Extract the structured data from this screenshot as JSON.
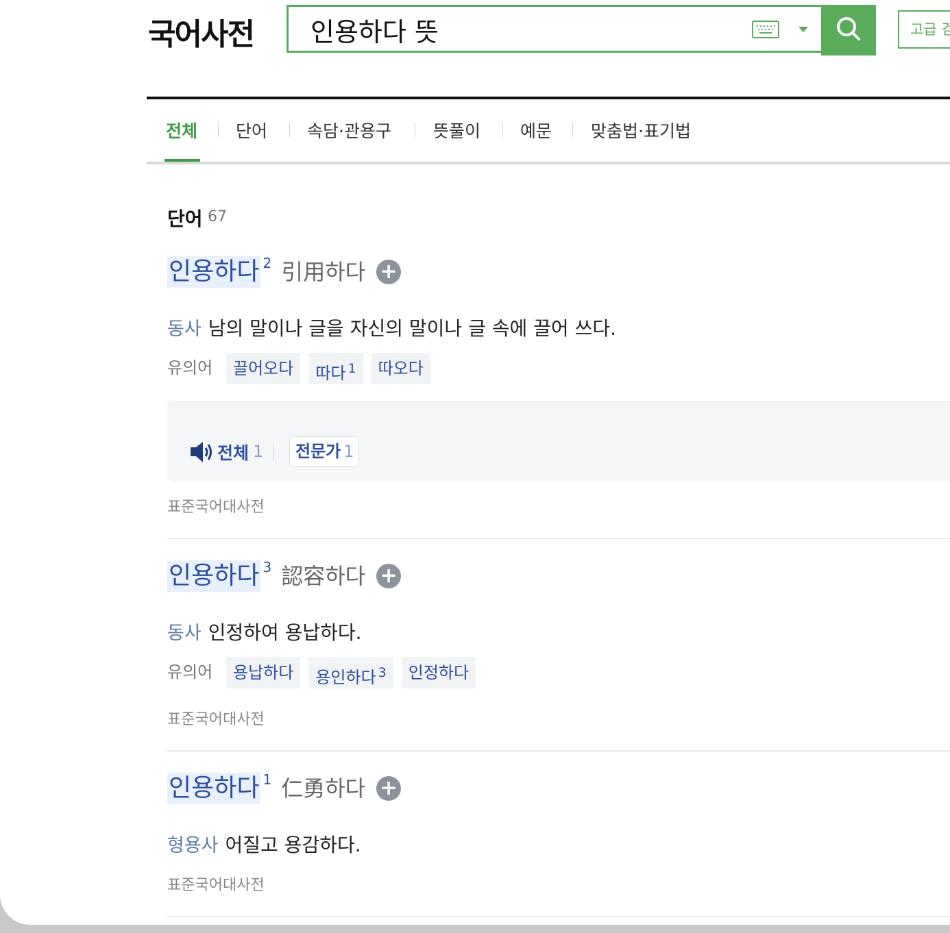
{
  "header": {
    "logo": "국어사전",
    "search_value": "인용하다 뜻",
    "keyboard_icon": "keyboard-icon",
    "dropdown_icon": "triangle-down-icon",
    "search_icon": "search-icon",
    "advanced_label": "고급 검색"
  },
  "tabs": [
    "전체",
    "단어",
    "속담·관용구",
    "뜻풀이",
    "예문",
    "맞춤법·표기법"
  ],
  "section": {
    "title": "단어",
    "count": "67"
  },
  "entries": [
    {
      "headword": "인용하다",
      "homograph": "2",
      "hanja": "引用하다",
      "pos": "동사",
      "definition": "남의 말이나 글을 자신의 말이나 글 속에 끌어 쓰다.",
      "synonym_label": "유의어",
      "synonyms": [
        {
          "word": "끌어오다",
          "sup": ""
        },
        {
          "word": "따다",
          "sup": "1"
        },
        {
          "word": "따오다",
          "sup": ""
        }
      ],
      "pronunciation": {
        "all_label": "전체",
        "all_count": "1",
        "expert_label": "전문가",
        "expert_count": "1"
      },
      "source": "표준국어대사전"
    },
    {
      "headword": "인용하다",
      "homograph": "3",
      "hanja": "認容하다",
      "pos": "동사",
      "definition": "인정하여 용납하다.",
      "synonym_label": "유의어",
      "synonyms": [
        {
          "word": "용납하다",
          "sup": ""
        },
        {
          "word": "용인하다",
          "sup": "3"
        },
        {
          "word": "인정하다",
          "sup": ""
        }
      ],
      "source": "표준국어대사전"
    },
    {
      "headword": "인용하다",
      "homograph": "1",
      "hanja": "仁勇하다",
      "pos": "형용사",
      "definition": "어질고 용감하다.",
      "source": "표준국어대사전"
    }
  ],
  "colors": {
    "brand_green": "#5aac5a",
    "active_tab": "#3c9b45",
    "link_blue": "#2b4f9e"
  }
}
